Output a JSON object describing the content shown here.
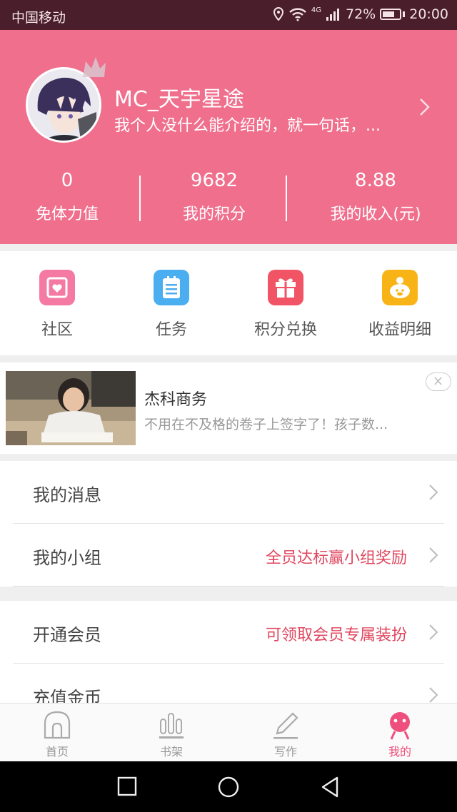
{
  "status_bar": {
    "carrier": "中国移动",
    "network": "4G",
    "battery": "72%",
    "battery_level": 0.72,
    "time": "20:00"
  },
  "profile": {
    "username": "MC_天宇星途",
    "bio": "我个人没什么能介绍的，就一句话，...",
    "stats": [
      {
        "value": "0",
        "label": "免体力值"
      },
      {
        "value": "9682",
        "label": "我的积分"
      },
      {
        "value": "8.88",
        "label": "我的收入(元)"
      }
    ]
  },
  "quick_menu": [
    {
      "label": "社区",
      "icon": "community-icon",
      "color": "#f47aa3"
    },
    {
      "label": "任务",
      "icon": "task-icon",
      "color": "#4aaef0"
    },
    {
      "label": "积分兑换",
      "icon": "gift-icon",
      "color": "#f15464"
    },
    {
      "label": "收益明细",
      "icon": "earnings-icon",
      "color": "#f8b416"
    }
  ],
  "ad": {
    "title": "杰科商务",
    "description": "不用在不及格的卷子上签字了！孩子数..."
  },
  "list_group_1": [
    {
      "label": "我的消息",
      "hint": ""
    },
    {
      "label": "我的小组",
      "hint": "全员达标赢小组奖励"
    }
  ],
  "list_group_2": [
    {
      "label": "开通会员",
      "hint": "可领取会员专属装扮"
    },
    {
      "label": "充值金币",
      "hint": ""
    }
  ],
  "tab_bar": [
    {
      "label": "首页",
      "icon": "home-icon"
    },
    {
      "label": "书架",
      "icon": "bookshelf-icon"
    },
    {
      "label": "写作",
      "icon": "pen-icon"
    },
    {
      "label": "我的",
      "icon": "profile-icon",
      "active": true
    }
  ],
  "colors": {
    "header": "#ef6f8d",
    "status_bar": "#4a1e2b",
    "accent_text": "#e0475f",
    "active_tab": "#ef4f7c"
  }
}
